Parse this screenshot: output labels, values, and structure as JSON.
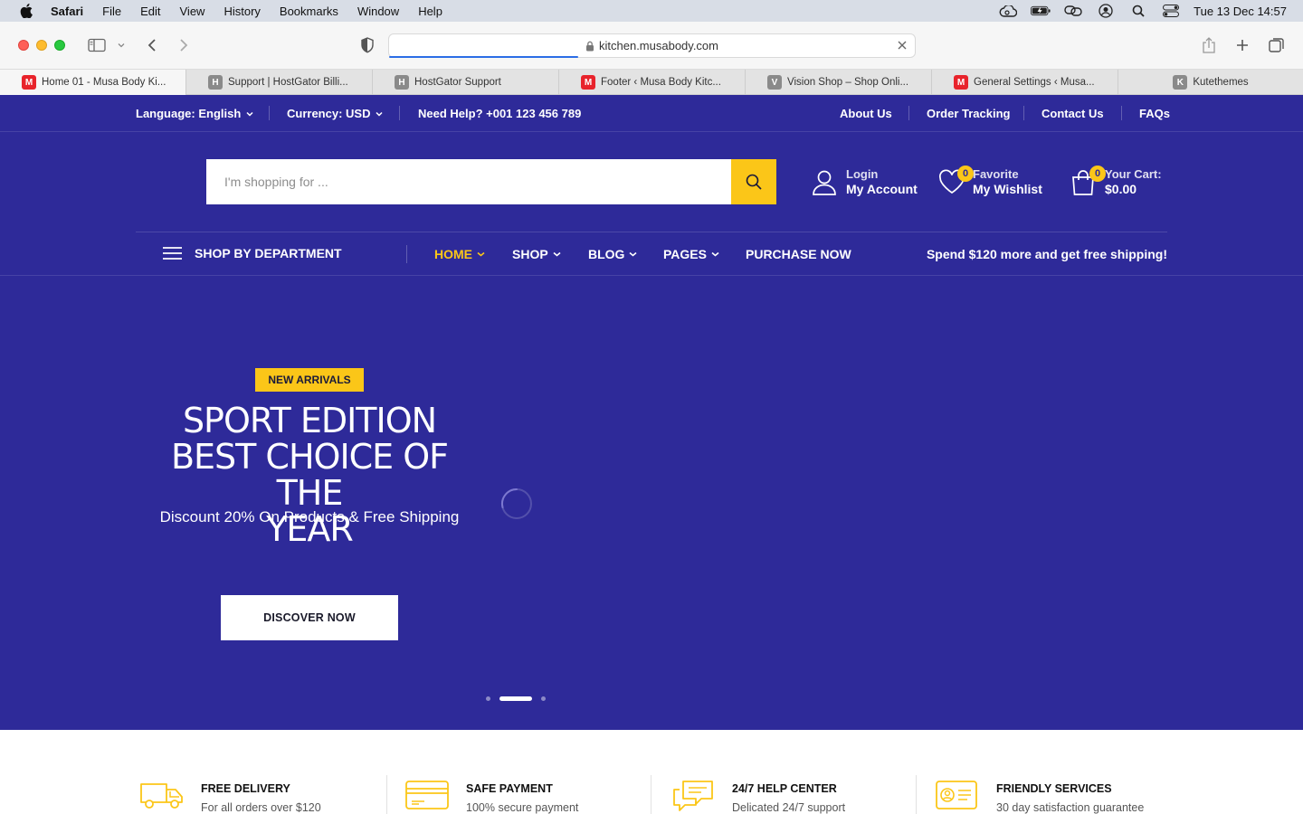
{
  "menubar": {
    "app": "Safari",
    "items": [
      "File",
      "Edit",
      "View",
      "History",
      "Bookmarks",
      "Window",
      "Help"
    ],
    "clock": "Tue 13 Dec  14:57"
  },
  "browser": {
    "url": "kitchen.musabody.com",
    "load_progress": 0.36,
    "tabs": [
      {
        "title": "Home 01 - Musa Body Ki...",
        "favicon": "M",
        "color": "#e8232b"
      },
      {
        "title": "Support | HostGator Billi...",
        "favicon": "H",
        "color": "#8a8a8a"
      },
      {
        "title": "HostGator Support",
        "favicon": "H",
        "color": "#8a8a8a"
      },
      {
        "title": "Footer ‹ Musa Body Kitc...",
        "favicon": "M",
        "color": "#e8232b"
      },
      {
        "title": "Vision Shop – Shop Onli...",
        "favicon": "V",
        "color": "#8a8a8a"
      },
      {
        "title": "General Settings ‹ Musa...",
        "favicon": "M",
        "color": "#e8232b"
      },
      {
        "title": "Kutethemes",
        "favicon": "K",
        "color": "#8a8a8a"
      }
    ]
  },
  "topbar": {
    "language": "Language: English",
    "currency": "Currency: USD",
    "help": "Need Help? +001 123 456 789",
    "links": [
      "About Us",
      "Order Tracking",
      "Contact Us",
      "FAQs"
    ]
  },
  "header": {
    "search_placeholder": "I'm shopping for ...",
    "account_small": "Login",
    "account_big": "My Account",
    "wishlist_small": "Favorite",
    "wishlist_big": "My Wishlist",
    "wishlist_count": "0",
    "cart_small": "Your Cart:",
    "cart_big": "$0.00",
    "cart_count": "0"
  },
  "nav": {
    "department": "SHOP BY DEPARTMENT",
    "items": [
      "HOME",
      "SHOP",
      "BLOG",
      "PAGES",
      "PURCHASE NOW"
    ],
    "promo": "Spend $120 more and get free shipping!"
  },
  "hero": {
    "badge": "NEW ARRIVALS",
    "title_line1": "SPORT EDITION",
    "title_line2": "BEST CHOICE OF THE",
    "title_line3": "YEAR",
    "subtitle": "Discount 20% On Products & Free Shipping",
    "cta": "DISCOVER NOW",
    "active_slide": 2,
    "slide_count": 3
  },
  "features": [
    {
      "title": "FREE DELIVERY",
      "desc": "For all orders over $120",
      "icon": "truck-icon"
    },
    {
      "title": "SAFE PAYMENT",
      "desc": "100% secure payment",
      "icon": "credit-card-icon"
    },
    {
      "title": "24/7 HELP CENTER",
      "desc": "Delicated 24/7 support",
      "icon": "chat-icon"
    },
    {
      "title": "FRIENDLY SERVICES",
      "desc": "30 day satisfaction guarantee",
      "icon": "id-card-icon"
    }
  ],
  "colors": {
    "brand": "#2e2a99",
    "accent": "#fbc618"
  }
}
